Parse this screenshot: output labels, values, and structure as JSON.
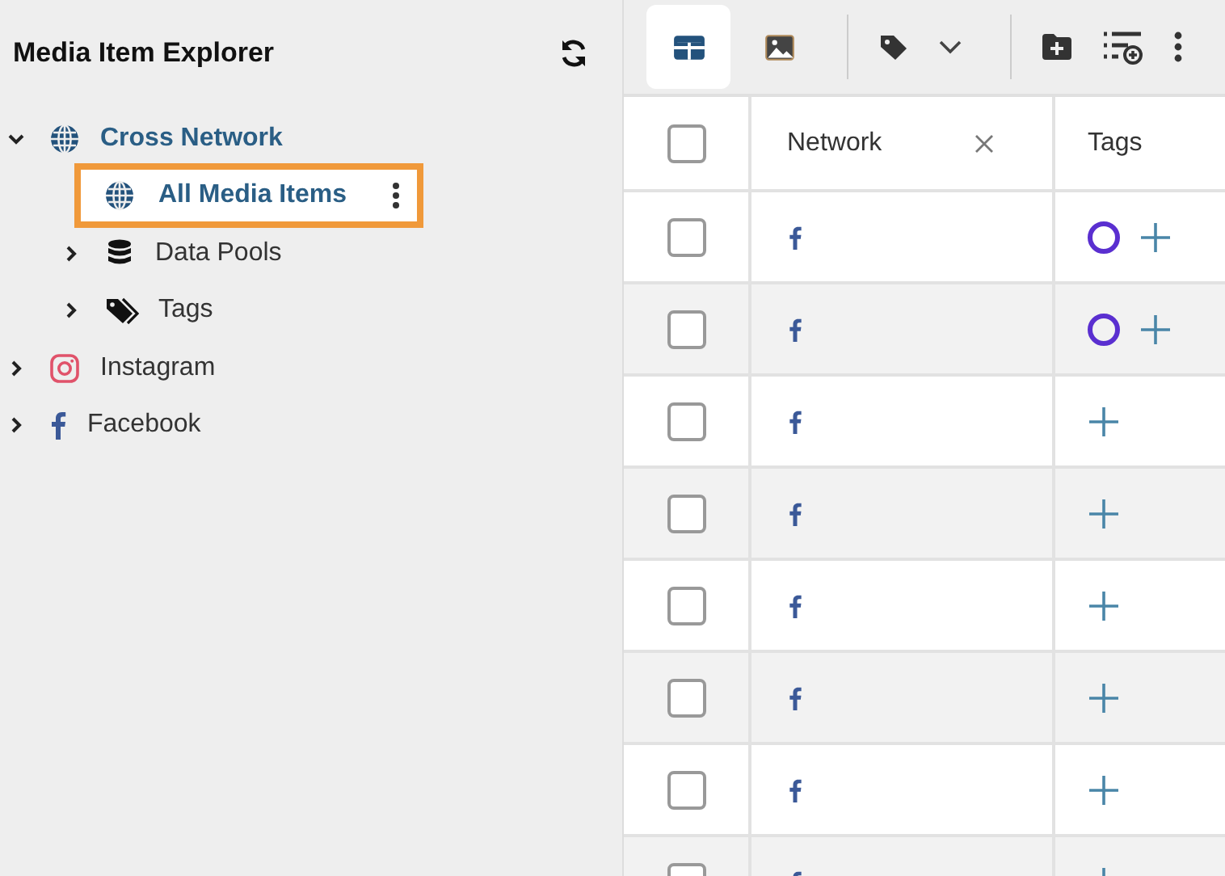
{
  "sidebar": {
    "title": "Media Item Explorer",
    "tree": [
      {
        "label": "Cross Network",
        "kind": "globe",
        "expanded": true,
        "selected": false,
        "children": [
          {
            "label": "All Media Items",
            "kind": "globe",
            "selected": true
          },
          {
            "label": "Data Pools",
            "kind": "database",
            "expanded": false,
            "selected": false
          },
          {
            "label": "Tags",
            "kind": "tag",
            "expanded": false,
            "selected": false
          }
        ]
      },
      {
        "label": "Instagram",
        "kind": "instagram",
        "expanded": false,
        "selected": false
      },
      {
        "label": "Facebook",
        "kind": "facebook",
        "expanded": false,
        "selected": false
      }
    ]
  },
  "toolbar": {
    "views": [
      {
        "kind": "grid",
        "selected": true
      },
      {
        "kind": "image",
        "selected": false
      }
    ]
  },
  "table": {
    "header_checkbox": {
      "checked": false
    },
    "columns": [
      {
        "label": "Network",
        "removable": true
      },
      {
        "label": "Tags",
        "removable": false
      }
    ],
    "rows": [
      {
        "checked": false,
        "tags": [
          {
            "color": "#5a2fd0"
          }
        ]
      },
      {
        "checked": false,
        "tags": [
          {
            "color": "#5a2fd0"
          }
        ]
      },
      {
        "checked": false,
        "tags": []
      },
      {
        "checked": false,
        "tags": []
      },
      {
        "checked": false,
        "tags": []
      },
      {
        "checked": false,
        "tags": []
      },
      {
        "checked": false,
        "tags": []
      },
      {
        "checked": false,
        "tags": []
      }
    ]
  }
}
